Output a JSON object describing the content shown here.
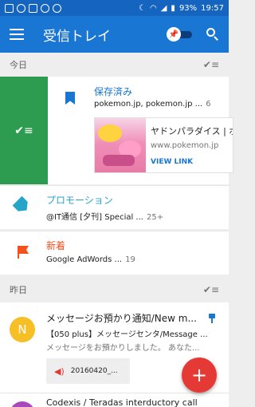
{
  "status_bar": {
    "battery": "93%",
    "time": "19:57"
  },
  "app_bar": {
    "title": "受信トレイ"
  },
  "sections": {
    "today": "今日",
    "yesterday": "昨日"
  },
  "saved_bundle": {
    "title": "保存済み",
    "senders": "pokemon.jp, pokemon.jp ...",
    "count": "6",
    "link": {
      "title": "ヤドンパラダイス | ポ",
      "domain": "www.pokemon.jp",
      "action": "VIEW LINK"
    }
  },
  "promotions": {
    "title": "プロモーション",
    "title_color": "#26a5c9",
    "snippet": "@IT通信 [夕刊] Special ...",
    "count": "25+"
  },
  "new_updates": {
    "title": "新着",
    "title_color": "#f4511e",
    "snippet": "Google AdWords ...",
    "count": "19"
  },
  "mail": {
    "avatar_letter": "N",
    "subject": "メッセージお預かり通知/New m...",
    "sender": "【050 plus】メッセージセンタ/Message ...",
    "snippet": "メッセージをお預かりしました。 あなた...",
    "attachment": "20160420_..."
  },
  "next_mail": {
    "subject": "Codexis / Teradas interductory call"
  },
  "fab": {
    "label": "+"
  }
}
